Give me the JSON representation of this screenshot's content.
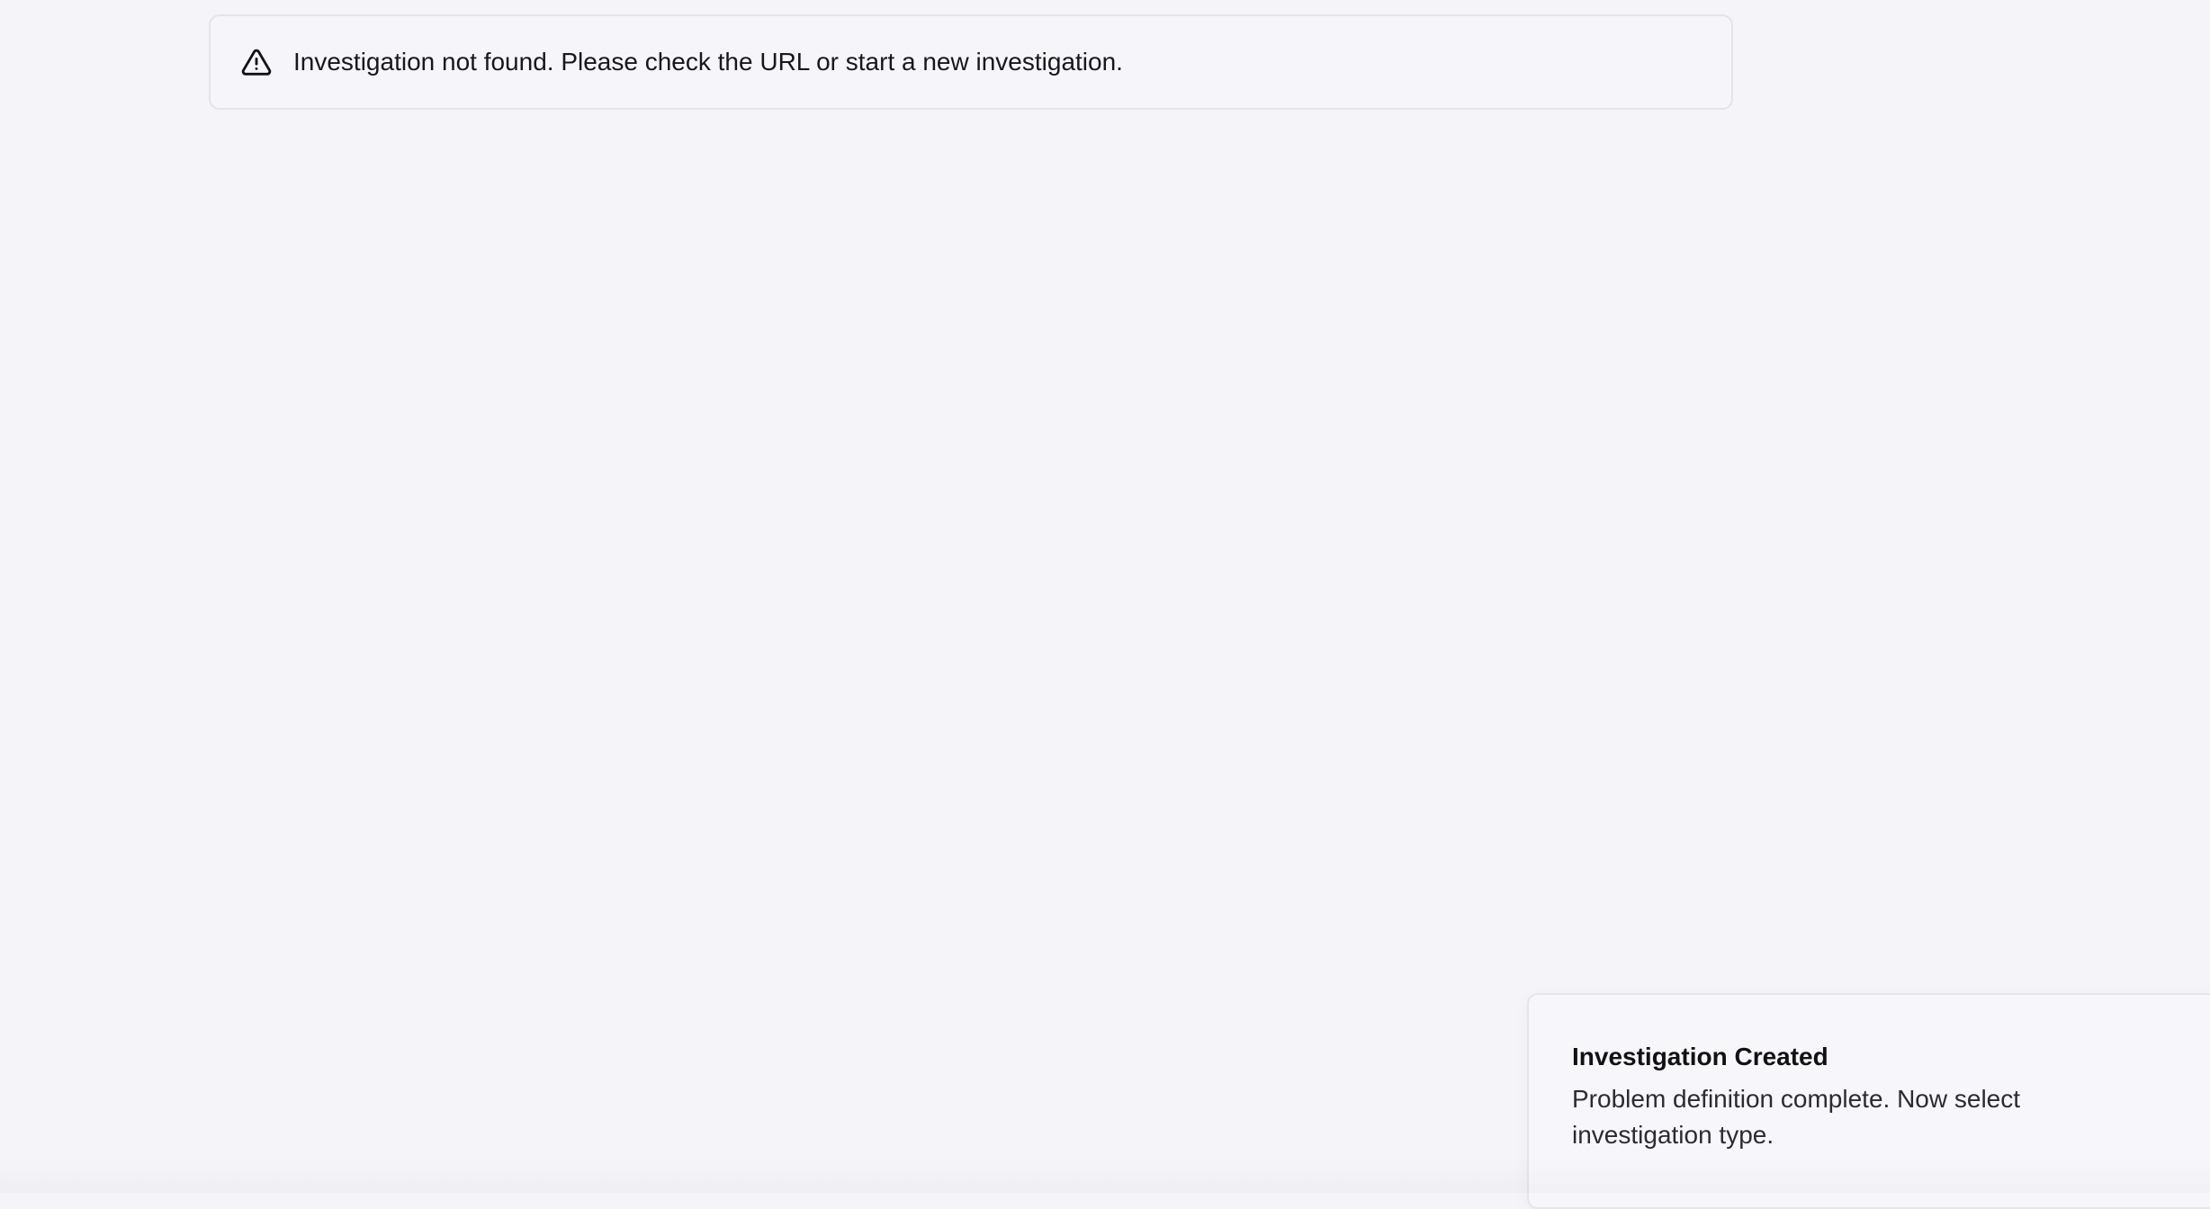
{
  "alert": {
    "icon": "warning-triangle-icon",
    "message": "Investigation not found. Please check the URL or start a new investigation."
  },
  "toast": {
    "title": "Investigation Created",
    "description": "Problem definition complete. Now select investigation type."
  },
  "colors": {
    "background": "#f5f4f9",
    "border": "#e4e3ea",
    "text": "#18181b"
  }
}
